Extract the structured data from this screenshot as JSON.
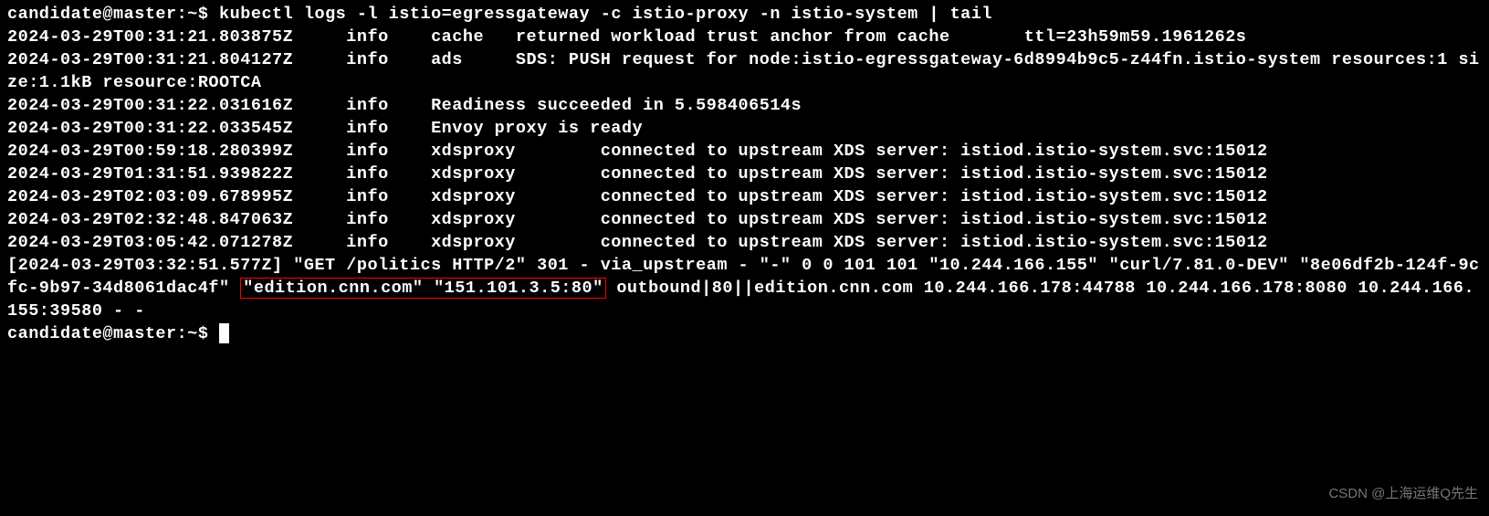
{
  "prompt1": "candidate@master:~$ ",
  "command": "kubectl logs -l istio=egressgateway -c istio-proxy -n istio-system | tail",
  "log_lines": [
    "2024-03-29T00:31:21.803875Z     info    cache   returned workload trust anchor from cache       ttl=23h59m59.1961262s",
    "2024-03-29T00:31:21.804127Z     info    ads     SDS: PUSH request for node:istio-egressgateway-6d8994b9c5-z44fn.istio-system resources:1 size:1.1kB resource:ROOTCA",
    "2024-03-29T00:31:22.031616Z     info    Readiness succeeded in 5.598406514s",
    "2024-03-29T00:31:22.033545Z     info    Envoy proxy is ready",
    "2024-03-29T00:59:18.280399Z     info    xdsproxy        connected to upstream XDS server: istiod.istio-system.svc:15012",
    "2024-03-29T01:31:51.939822Z     info    xdsproxy        connected to upstream XDS server: istiod.istio-system.svc:15012",
    "2024-03-29T02:03:09.678995Z     info    xdsproxy        connected to upstream XDS server: istiod.istio-system.svc:15012",
    "2024-03-29T02:32:48.847063Z     info    xdsproxy        connected to upstream XDS server: istiod.istio-system.svc:15012",
    "2024-03-29T03:05:42.071278Z     info    xdsproxy        connected to upstream XDS server: istiod.istio-system.svc:15012"
  ],
  "final_log": {
    "part1": "[2024-03-29T03:32:51.577Z] \"GET /politics HTTP/2\" 301 - via_upstream - \"-\" 0 0 101 101 \"10.244.166.155\" \"curl/7.81.0-DEV\" \"8e06df2b-124f-9cfc-9b97-34d8061dac4f\" ",
    "highlighted": "\"edition.cnn.com\" \"151.101.3.5:80\"",
    "part2": " outbound|80||edition.cnn.com 10.244.166.178:44788 10.244.166.178:8080 10.244.166.155:39580 - -"
  },
  "prompt2": "candidate@master:~$ ",
  "watermark": "CSDN @上海运维Q先生"
}
